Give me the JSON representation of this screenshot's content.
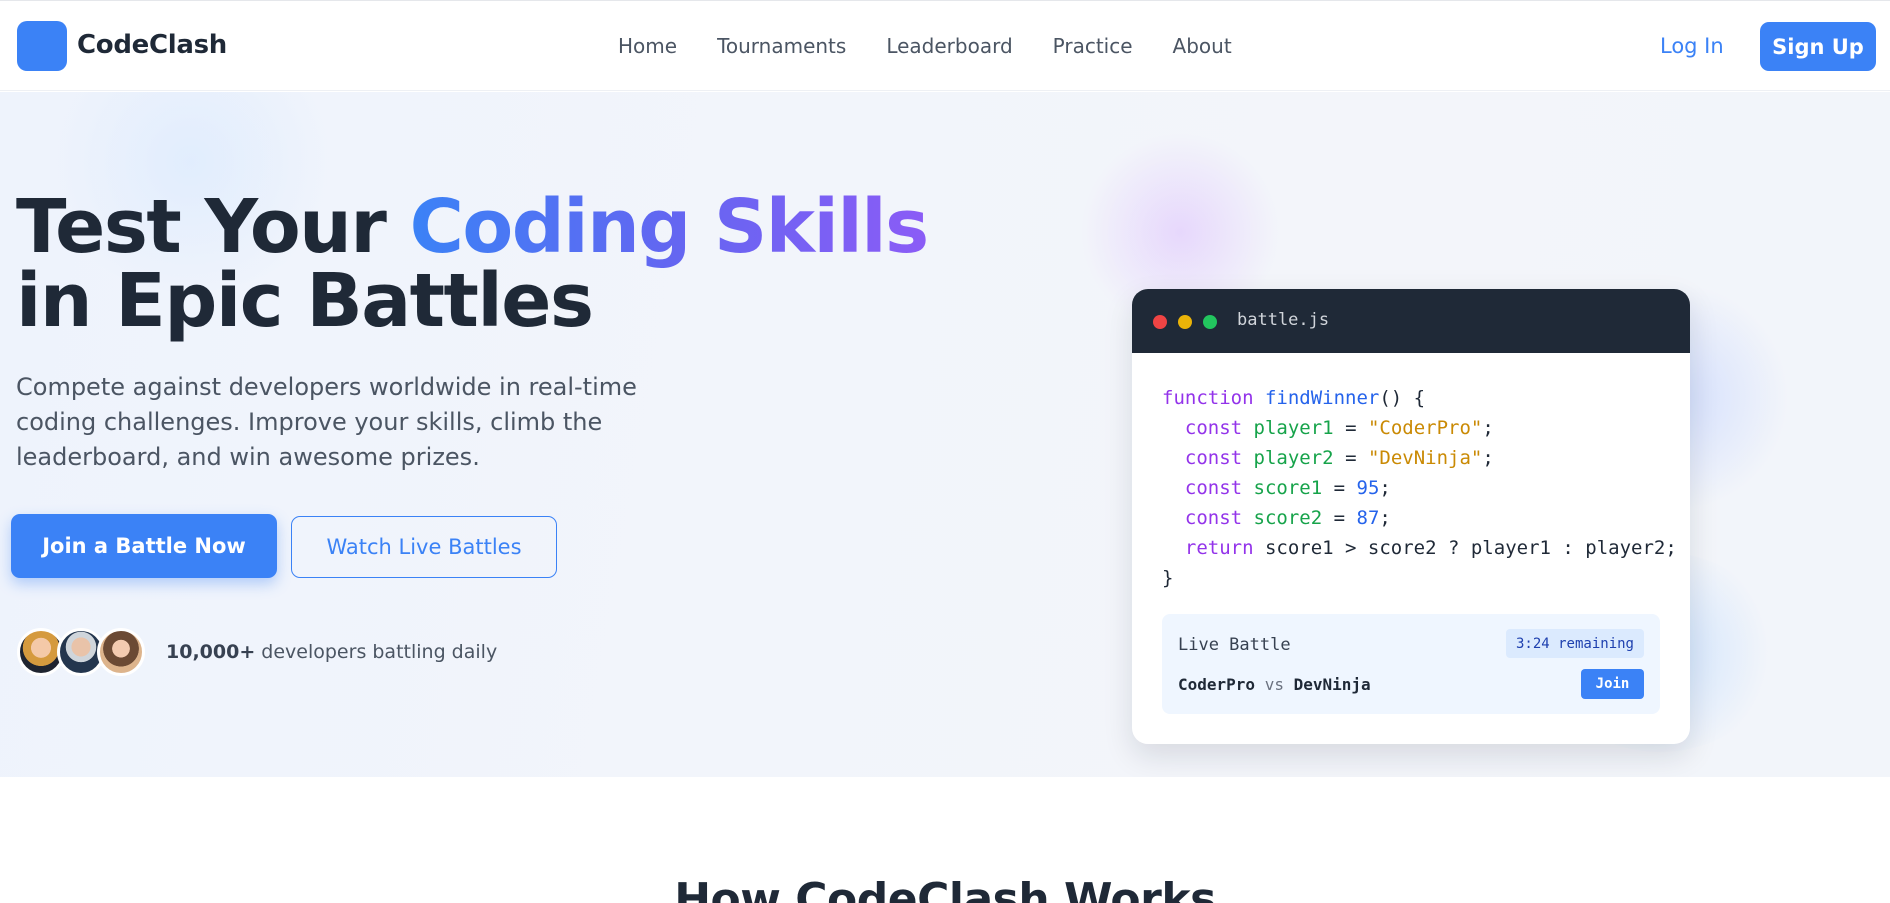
{
  "nav": {
    "brand": "CodeClash",
    "links": [
      "Home",
      "Tournaments",
      "Leaderboard",
      "Practice",
      "About"
    ],
    "login": "Log In",
    "signup": "Sign Up"
  },
  "hero": {
    "headline_part1": "Test Your ",
    "headline_highlight": "Coding Skills",
    "headline_part2": "in Epic Battles",
    "subtext": "Compete against developers worldwide in real-time coding challenges. Improve your skills, climb the leaderboard, and win awesome prizes.",
    "primary_cta": "Join a Battle Now",
    "secondary_cta": "Watch Live Battles",
    "social_count": "10,000+",
    "social_text": " developers battling daily"
  },
  "code_card": {
    "filename": "battle.js",
    "live_label": "Live Battle",
    "timer": "3:24 remaining",
    "player1": "CoderPro",
    "vs": "vs",
    "player2": "DevNinja",
    "join": "Join"
  },
  "colors": {
    "accent": "#3b82f6",
    "gradient_start": "#3b82f6",
    "gradient_end": "#8b5cf6",
    "editor_header": "#1f2937"
  },
  "section": {
    "title": "How CodeClash Works"
  }
}
